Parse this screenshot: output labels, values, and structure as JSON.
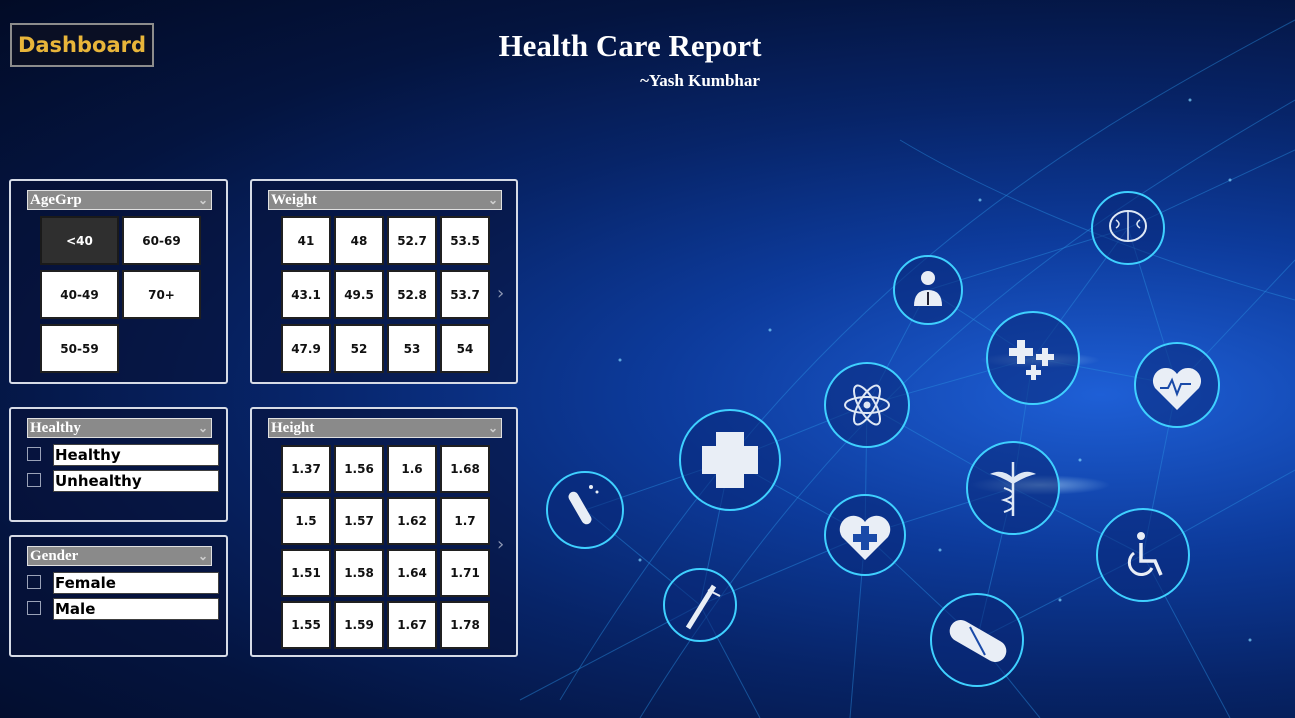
{
  "header": {
    "dashboard_label": "Dashboard",
    "title": "Health Care Report",
    "author": "~Yash Kumbhar"
  },
  "agegrp": {
    "title": "AgeGrp",
    "selected": "<40",
    "tiles": [
      "<40",
      "60-69",
      "40-49",
      "70+",
      "50-59"
    ]
  },
  "weight": {
    "title": "Weight",
    "tiles": [
      "41",
      "48",
      "52.7",
      "53.5",
      "43.1",
      "49.5",
      "52.8",
      "53.7",
      "47.9",
      "52",
      "53",
      "54"
    ]
  },
  "height": {
    "title": "Height",
    "tiles": [
      "1.37",
      "1.56",
      "1.6",
      "1.68",
      "1.5",
      "1.57",
      "1.62",
      "1.7",
      "1.51",
      "1.58",
      "1.64",
      "1.71",
      "1.55",
      "1.59",
      "1.67",
      "1.78"
    ]
  },
  "healthy": {
    "title": "Healthy",
    "options": [
      "Healthy",
      "Unhealthy"
    ]
  },
  "gender": {
    "title": "Gender",
    "options": [
      "Female",
      "Male"
    ]
  },
  "theme": {
    "accent_gold": "#e8b53a",
    "glow_cyan": "#3fd0ff",
    "bg_dark": "#020b26",
    "bg_blue": "#1e5fd6"
  },
  "background_icons": [
    "brain-icon",
    "doctor-icon",
    "medical-crosses-icon",
    "heart-rate-icon",
    "atom-icon",
    "medical-cross-icon",
    "caduceus-icon",
    "test-tube-icon",
    "heart-cross-icon",
    "wheelchair-icon",
    "syringe-icon",
    "pill-icon"
  ]
}
